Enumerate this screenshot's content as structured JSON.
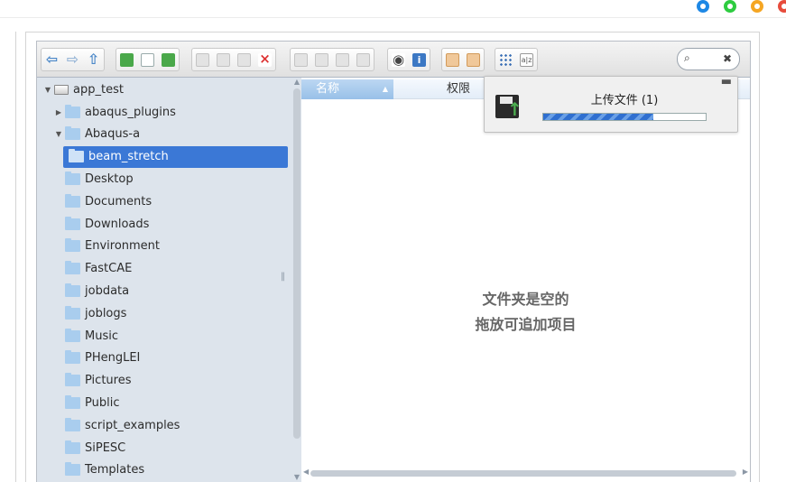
{
  "window_controls": [
    {
      "name": "circle-target-icon",
      "color": "#1e88e5"
    },
    {
      "name": "minimize-icon",
      "color": "#2ecc40"
    },
    {
      "name": "maximize-icon",
      "color": "#f5a623"
    },
    {
      "name": "close-icon",
      "color": "#e74c3c"
    }
  ],
  "toolbar": {
    "groups": [
      [
        "back-icon",
        "forward-icon",
        "up-icon"
      ],
      [
        "reload-icon",
        "new-file-icon",
        "save-icon"
      ],
      [
        "copy-icon",
        "cut-icon",
        "paste-icon",
        "delete-icon"
      ],
      [
        "duplicate-icon",
        "select-icon",
        "rename-icon",
        "extract-icon"
      ],
      [
        "preview-icon",
        "info-icon"
      ],
      [
        "upload-icon",
        "download-icon"
      ],
      [
        "grid-view-icon",
        "sort-az-icon"
      ]
    ]
  },
  "search": {
    "placeholder": ""
  },
  "tree": {
    "root": "app_test",
    "items": [
      {
        "label": "abaqus_plugins",
        "indent": 1,
        "expander": "▶"
      },
      {
        "label": "Abaqus-a",
        "indent": 1,
        "expander": "▼"
      },
      {
        "label": "beam_stretch",
        "indent": 2,
        "selected": true
      },
      {
        "label": "Desktop",
        "indent": 1
      },
      {
        "label": "Documents",
        "indent": 1
      },
      {
        "label": "Downloads",
        "indent": 1
      },
      {
        "label": "Environment",
        "indent": 1
      },
      {
        "label": "FastCAE",
        "indent": 1
      },
      {
        "label": "jobdata",
        "indent": 1
      },
      {
        "label": "joblogs",
        "indent": 1
      },
      {
        "label": "Music",
        "indent": 1
      },
      {
        "label": "PHengLEI",
        "indent": 1
      },
      {
        "label": "Pictures",
        "indent": 1
      },
      {
        "label": "Public",
        "indent": 1
      },
      {
        "label": "script_examples",
        "indent": 1
      },
      {
        "label": "SiPESC",
        "indent": 1
      },
      {
        "label": "Templates",
        "indent": 1
      }
    ]
  },
  "columns": {
    "name": "名称",
    "permissions": "权限"
  },
  "empty": {
    "line1": "文件夹是空的",
    "line2": "拖放可追加项目"
  },
  "upload": {
    "title": "上传文件 (1)",
    "progress": 0.68
  },
  "colors": {
    "selection": "#3b78d6",
    "tree_bg": "#dde4ec",
    "folder": "#a9cdee"
  }
}
